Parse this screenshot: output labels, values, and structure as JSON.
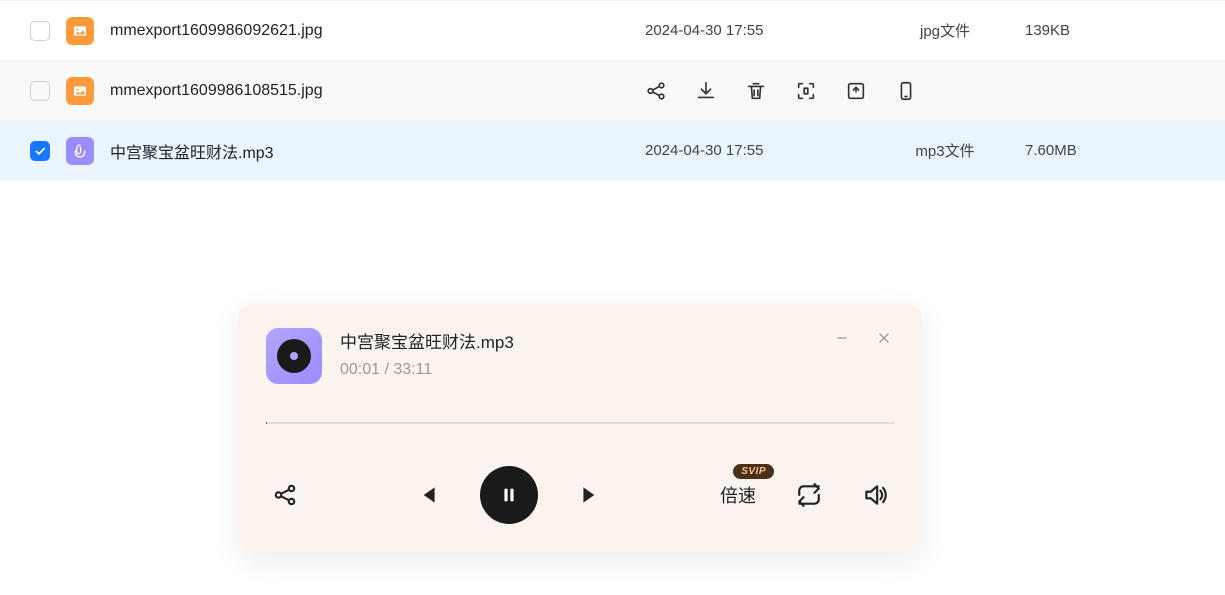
{
  "files": [
    {
      "name": "mmexport1609986092621.jpg",
      "date": "2024-04-30 17:55",
      "type": "jpg文件",
      "size": "139KB",
      "icon": "img",
      "selected": false,
      "hovered": false
    },
    {
      "name": "mmexport1609986108515.jpg",
      "date": "",
      "type": "",
      "size": "",
      "icon": "img",
      "selected": false,
      "hovered": true
    },
    {
      "name": "中宫聚宝盆旺财法.mp3",
      "date": "2024-04-30 17:55",
      "type": "mp3文件",
      "size": "7.60MB",
      "icon": "audio",
      "selected": true,
      "hovered": false
    }
  ],
  "player": {
    "title": "中宫聚宝盆旺财法.mp3",
    "elapsed": "00:01",
    "duration": "33:11",
    "time_display": "00:01 / 33:11",
    "speed_label": "倍速",
    "svip_label": "SVIP"
  }
}
